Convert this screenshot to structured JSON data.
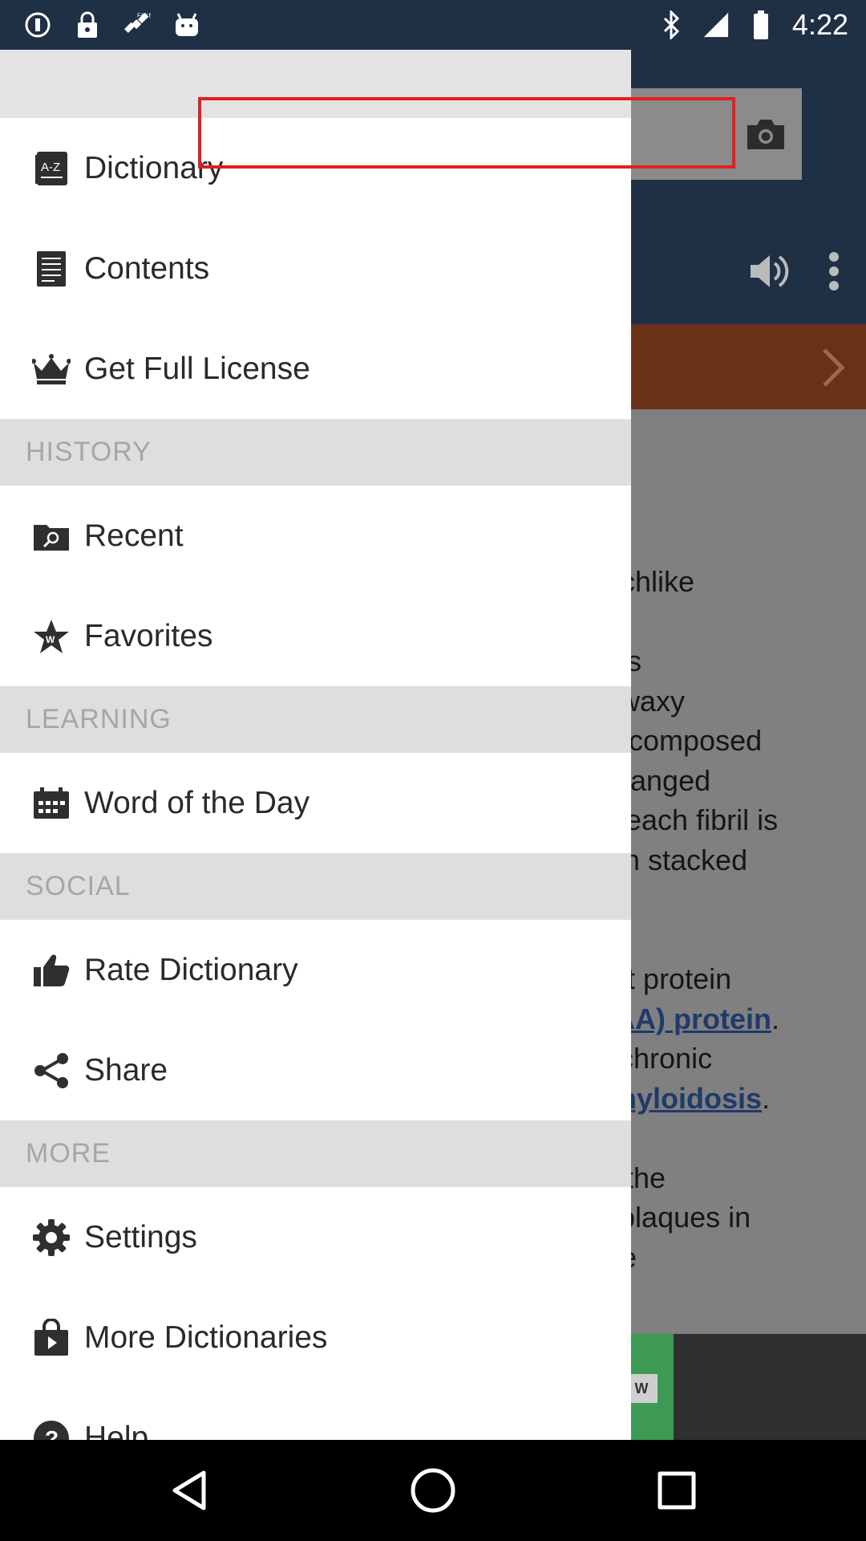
{
  "status_bar": {
    "time": "4:22",
    "left_icons": [
      "info-circle-icon",
      "lock-icon",
      "fake-gps-satellite-icon",
      "android-icon"
    ],
    "right_icons": [
      "bluetooth-icon",
      "signal-icon",
      "battery-icon"
    ]
  },
  "drawer": {
    "items_top": [
      {
        "label": "Dictionary",
        "icon": "a-z-book-icon"
      },
      {
        "label": "Contents",
        "icon": "document-list-icon"
      },
      {
        "label": "Get Full License",
        "icon": "crown-icon"
      }
    ],
    "sections": {
      "history": {
        "title": "HISTORY",
        "items": [
          {
            "label": "Recent",
            "icon": "folder-search-icon"
          },
          {
            "label": "Favorites",
            "icon": "star-w-icon"
          }
        ]
      },
      "learning": {
        "title": "LEARNING",
        "items": [
          {
            "label": "Word of the Day",
            "icon": "calendar-icon"
          }
        ]
      },
      "social": {
        "title": "SOCIAL",
        "items": [
          {
            "label": "Rate Dictionary",
            "icon": "thumbs-up-icon"
          },
          {
            "label": "Share",
            "icon": "share-icon"
          }
        ]
      },
      "more": {
        "title": "MORE",
        "items": [
          {
            "label": "Settings",
            "icon": "gear-icon"
          },
          {
            "label": "More Dictionaries",
            "icon": "shopping-bag-icon"
          },
          {
            "label": "Help",
            "icon": "help-circle-icon"
          }
        ]
      }
    }
  },
  "background_article": {
    "lines": [
      "archlike",
      "",
      "ous",
      "a waxy",
      "re composed",
      "arranged",
      "k; each fibril is",
      "s in stacked",
      "",
      "",
      "ght protein",
      "SAA) protein.",
      "o chronic",
      "amyloidosis.",
      "",
      "in the",
      "e plaques in",
      "rge"
    ],
    "link_texts": [
      "SAA) protein",
      "amyloidosis"
    ],
    "ad_button": "W"
  },
  "colors": {
    "header": "#1f2f44",
    "banner": "#6b3117",
    "highlight": "#e02020",
    "section_bg": "#dedede",
    "section_text": "#a6a6a6"
  }
}
